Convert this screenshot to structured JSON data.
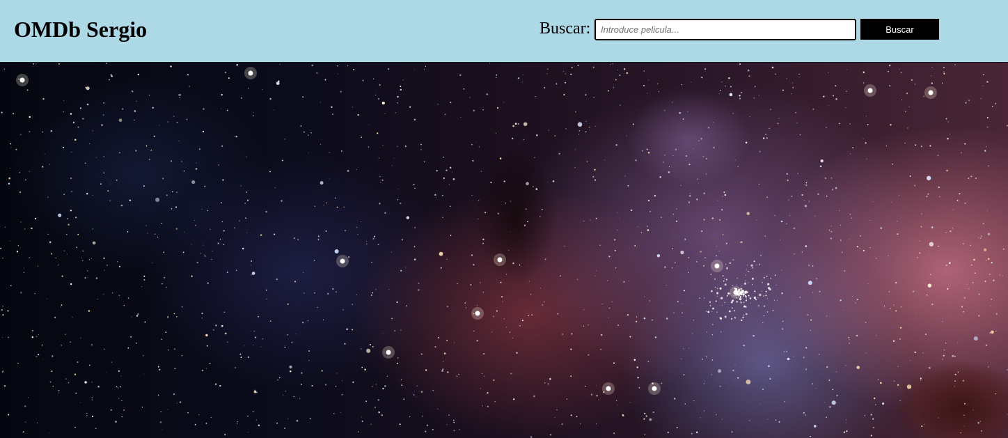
{
  "header": {
    "title": "OMDb Sergio",
    "background_color": "#add8e6"
  },
  "search": {
    "label": "Buscar:",
    "placeholder": "Introduce pelicula...",
    "value": "",
    "button_label": "Buscar"
  },
  "hero": {
    "image": "starfield-nebula-background"
  }
}
